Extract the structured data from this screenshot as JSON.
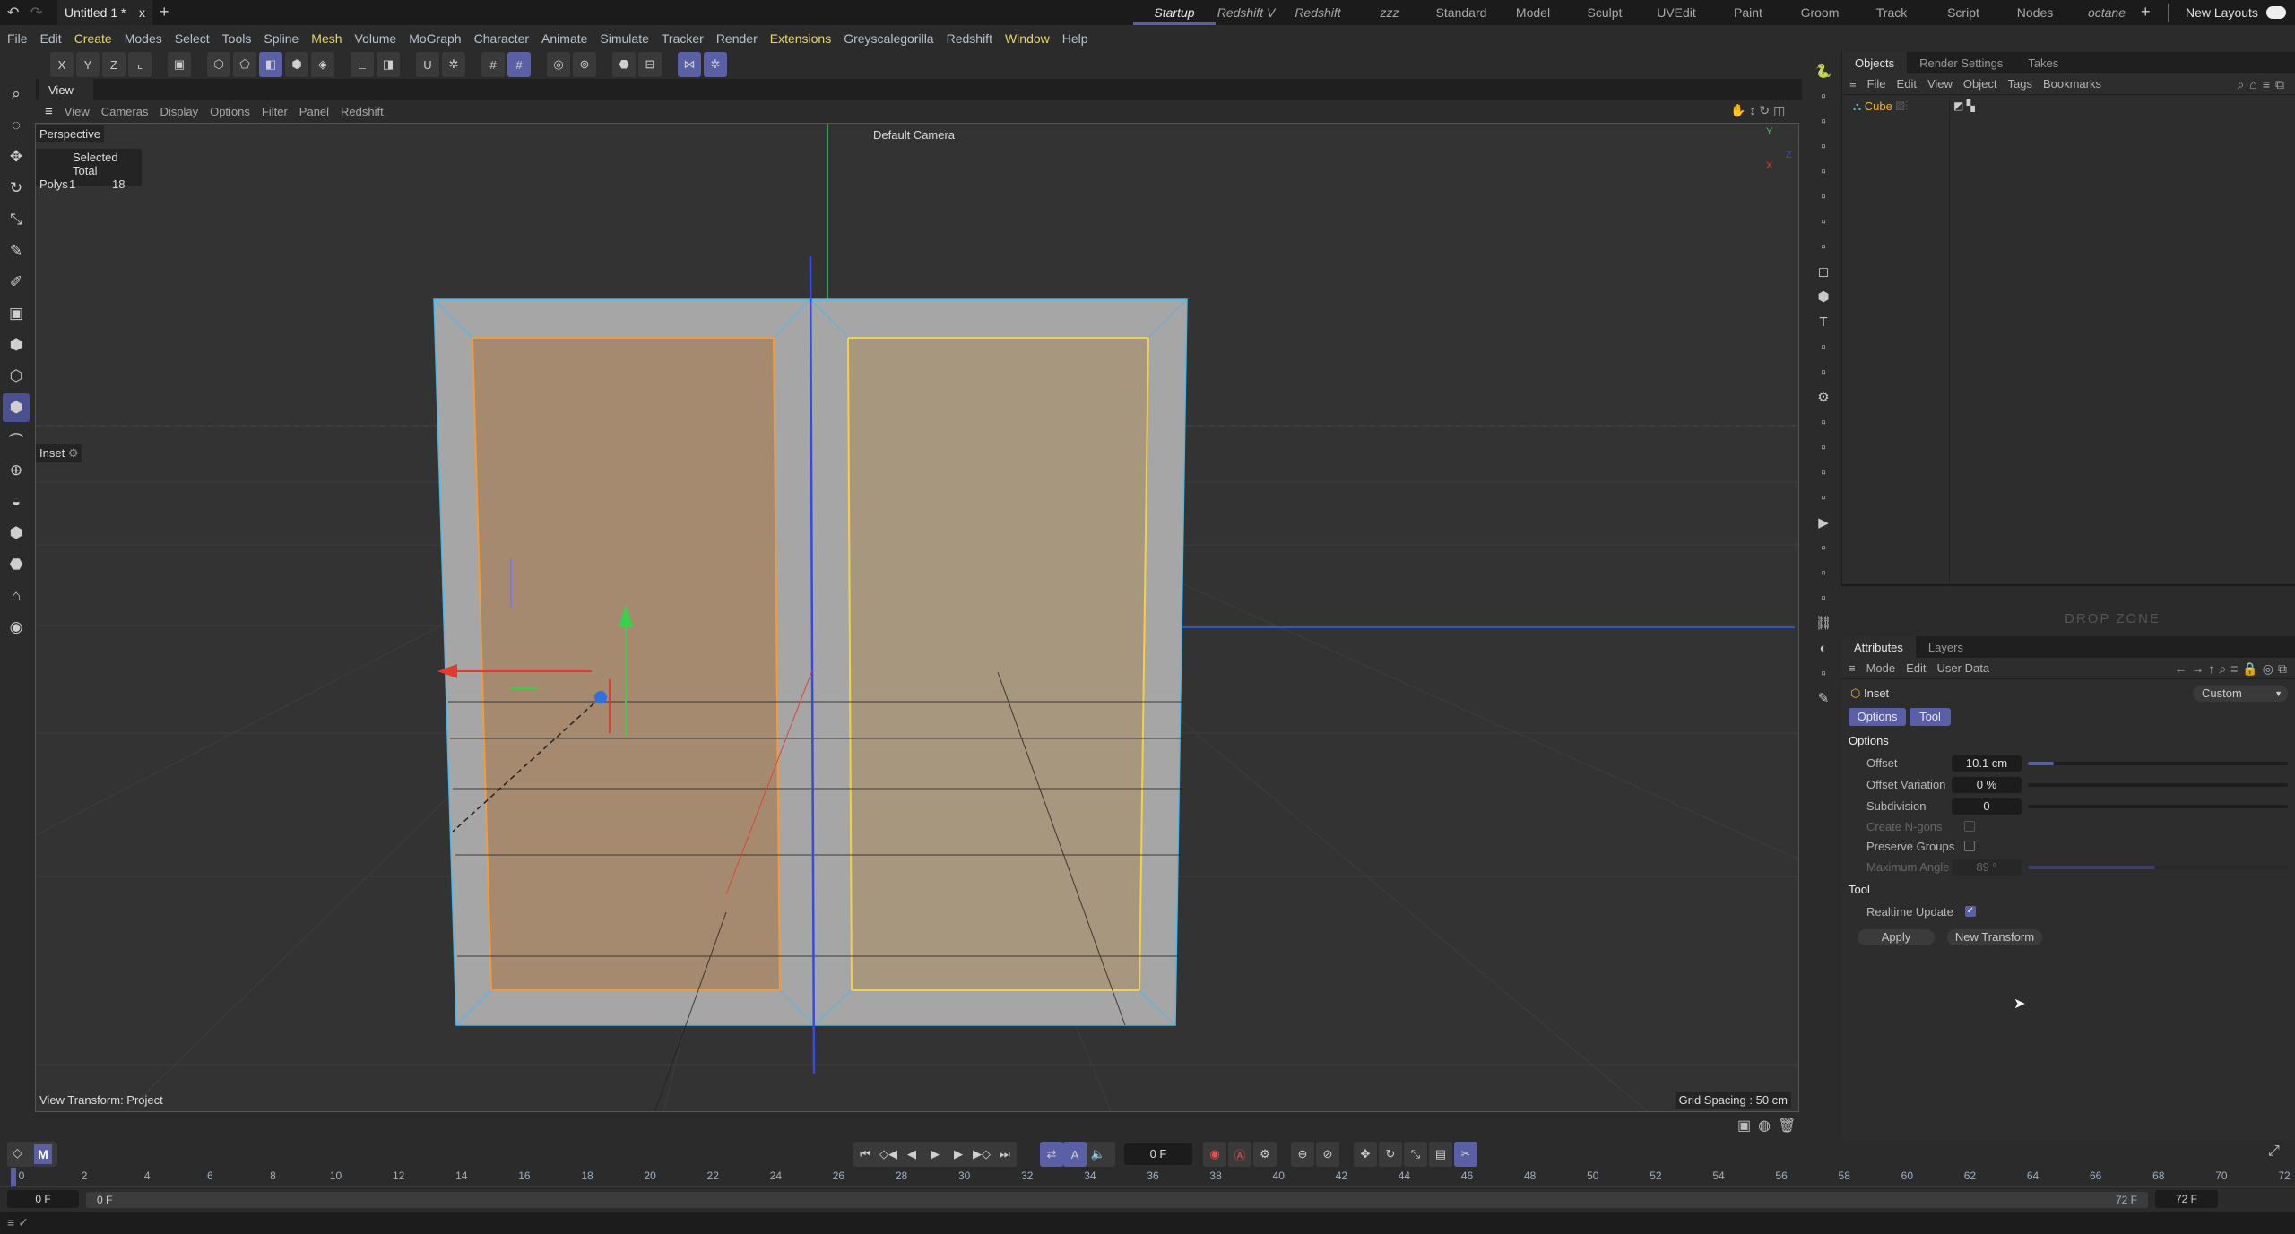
{
  "topbar": {
    "document_tab": "Untitled 1 *",
    "close": "x",
    "new_tab": "+",
    "layouts": [
      {
        "label": "Startup",
        "italic": true,
        "active": true
      },
      {
        "label": "Redshift V",
        "italic": true
      },
      {
        "label": "Redshift",
        "italic": true
      },
      {
        "label": "zzz",
        "italic": true
      },
      {
        "label": "Standard"
      },
      {
        "label": "Model"
      },
      {
        "label": "Sculpt"
      },
      {
        "label": "UVEdit"
      },
      {
        "label": "Paint"
      },
      {
        "label": "Groom"
      },
      {
        "label": "Track"
      },
      {
        "label": "Script"
      },
      {
        "label": "Nodes"
      },
      {
        "label": "octane",
        "italic": true
      }
    ],
    "add_layout": "+",
    "new_layouts": "New Layouts"
  },
  "menubar": [
    {
      "label": "File"
    },
    {
      "label": "Edit"
    },
    {
      "label": "Create",
      "hl": true
    },
    {
      "label": "Modes"
    },
    {
      "label": "Select"
    },
    {
      "label": "Tools"
    },
    {
      "label": "Spline"
    },
    {
      "label": "Mesh",
      "hl": true
    },
    {
      "label": "Volume"
    },
    {
      "label": "MoGraph"
    },
    {
      "label": "Character"
    },
    {
      "label": "Animate"
    },
    {
      "label": "Simulate"
    },
    {
      "label": "Tracker"
    },
    {
      "label": "Render"
    },
    {
      "label": "Extensions",
      "hl": true
    },
    {
      "label": "Greyscalegorilla"
    },
    {
      "label": "Redshift"
    },
    {
      "label": "Window",
      "hl": true
    },
    {
      "label": "Help"
    }
  ],
  "toolbar": [
    {
      "icon": "x-axis-icon",
      "g": "X"
    },
    {
      "icon": "y-axis-icon",
      "g": "Y"
    },
    {
      "icon": "z-axis-icon",
      "g": "Z"
    },
    {
      "icon": "coordinate-system-icon",
      "g": "⌞"
    },
    {
      "gap": true
    },
    {
      "icon": "clapboard-icon",
      "g": "▣"
    },
    {
      "gap": true
    },
    {
      "icon": "points-mode-icon",
      "g": "⬡"
    },
    {
      "icon": "edges-mode-icon",
      "g": "⬠"
    },
    {
      "icon": "polygons-mode-icon",
      "g": "◧",
      "on": true
    },
    {
      "icon": "model-mode-icon",
      "g": "⬢"
    },
    {
      "icon": "texture-mode-icon",
      "g": "◈"
    },
    {
      "gap": true
    },
    {
      "icon": "axis-mode-icon",
      "g": "∟"
    },
    {
      "icon": "solo-icon",
      "g": "◨"
    },
    {
      "gap": true
    },
    {
      "icon": "magnet-icon",
      "g": "U"
    },
    {
      "icon": "snap-settings-icon",
      "g": "✲"
    },
    {
      "gap": true
    },
    {
      "icon": "grid-icon",
      "g": "#"
    },
    {
      "icon": "grid-lock-icon",
      "g": "#",
      "on": true
    },
    {
      "gap": true
    },
    {
      "icon": "render-view-icon",
      "g": "◎"
    },
    {
      "icon": "render-settings-icon",
      "g": "⊚"
    },
    {
      "gap": true
    },
    {
      "icon": "render-region-icon",
      "g": "⬣"
    },
    {
      "icon": "picture-viewer-icon",
      "g": "⊟"
    },
    {
      "gap": true
    },
    {
      "icon": "symmetry-icon",
      "g": "⋈",
      "on": true
    },
    {
      "icon": "symmetry-settings-icon",
      "g": "✲",
      "on": true
    }
  ],
  "left_tools": [
    {
      "icon": "search-icon",
      "g": "⌕"
    },
    {
      "icon": "live-selection-icon",
      "g": "◌"
    },
    {
      "icon": "move-icon",
      "g": "✥"
    },
    {
      "icon": "rotate-icon",
      "g": "↻"
    },
    {
      "icon": "scale-icon",
      "g": "⤡"
    },
    {
      "icon": "knife-icon",
      "g": "✎"
    },
    {
      "icon": "brush-icon",
      "g": "✐"
    },
    {
      "icon": "polygon-pen-icon",
      "g": "▣"
    },
    {
      "icon": "extrude-icon",
      "g": "⬢"
    },
    {
      "icon": "extrude-inner-icon",
      "g": "⬡"
    },
    {
      "icon": "inset-icon",
      "g": "⬢",
      "on": true
    },
    {
      "icon": "bridge-icon",
      "g": "⌒"
    },
    {
      "icon": "weld-icon",
      "g": "⊕"
    },
    {
      "icon": "bevel-icon",
      "g": "◒"
    },
    {
      "icon": "loop-cut-icon",
      "g": "⬢"
    },
    {
      "icon": "slide-icon",
      "g": "⬣"
    },
    {
      "icon": "iron-icon",
      "g": "⌂"
    },
    {
      "icon": "camera-icon",
      "g": "◉"
    }
  ],
  "viewport": {
    "tab": "View",
    "menu": [
      "View",
      "Cameras",
      "Display",
      "Options",
      "Filter",
      "Panel",
      "Redshift"
    ],
    "camera_name": "Perspective",
    "camera": "Default Camera",
    "stats_header": "Selected Total",
    "stats_label": "Polys",
    "stats_selected": "1",
    "stats_total": "18",
    "tool_name": "Inset",
    "view_transform": "View Transform: Project",
    "grid_spacing": "Grid Spacing : 50 cm",
    "axis_y": "Y",
    "axis_z": "Z",
    "axis_x": "X"
  },
  "right_tools": [
    "python-icon",
    "import-icon",
    "arrow-up-icon",
    "null-icon",
    "scale-object-icon",
    "help-icon",
    "light-icon",
    "point-light-icon",
    "cube-icon",
    "box-icon",
    "text-icon",
    "cloner-icon",
    "tree-icon",
    "gear-icon",
    "deformer-icon",
    "spline-icon",
    "mograph-icon",
    "redshift-icon",
    "camera-icon",
    "render-icon",
    "film-icon",
    "hex-icon",
    "link-icon",
    "sphere-icon",
    "paint-icon",
    "pen-icon"
  ],
  "objects": {
    "tabs": [
      "Objects",
      "Render Settings",
      "Takes"
    ],
    "menu": [
      "File",
      "Edit",
      "View",
      "Object",
      "Tags",
      "Bookmarks"
    ],
    "items": [
      {
        "name": "Cube"
      }
    ]
  },
  "dropzone": "DROP ZONE",
  "attributes": {
    "tabs": [
      "Attributes",
      "Layers"
    ],
    "menu": [
      "Mode",
      "Edit",
      "User Data"
    ],
    "tool": "Inset",
    "preset": "Custom",
    "subtabs": [
      "Options",
      "Tool"
    ],
    "options_header": "Options",
    "offset_label": "Offset",
    "offset": "10.1 cm",
    "offset_fraction": 0.1,
    "offset_var_label": "Offset Variation",
    "offset_var": "0 %",
    "subdiv_label": "Subdivision",
    "subdiv": "0",
    "ngons_label": "Create N-gons",
    "ngons": false,
    "preserve_label": "Preserve Groups",
    "preserve": false,
    "max_angle_label": "Maximum Angle",
    "max_angle": "89 °",
    "max_angle_fraction": 0.49,
    "tool_header": "Tool",
    "realtime_label": "Realtime Update",
    "realtime": true,
    "apply": "Apply",
    "new_transform": "New Transform"
  },
  "timeline": {
    "current_frame": "0 F",
    "start": "0 F",
    "range_start": "0 F",
    "range_end": "72 F",
    "end": "72 F",
    "ticks": [
      0,
      2,
      4,
      6,
      8,
      10,
      12,
      14,
      16,
      18,
      20,
      22,
      24,
      26,
      28,
      30,
      32,
      34,
      36,
      38,
      40,
      42,
      44,
      46,
      48,
      50,
      52,
      54,
      56,
      58,
      60,
      62,
      64,
      66,
      68,
      70,
      72
    ],
    "transport": [
      "first-frame-icon",
      "prev-key-icon",
      "prev-frame-icon",
      "play-icon",
      "next-frame-icon",
      "next-key-icon",
      "last-frame-icon"
    ]
  },
  "colors": {
    "accent": "#5b5fa6",
    "face_selected": "#a68a6f",
    "face_unselected": "#a8977f"
  }
}
